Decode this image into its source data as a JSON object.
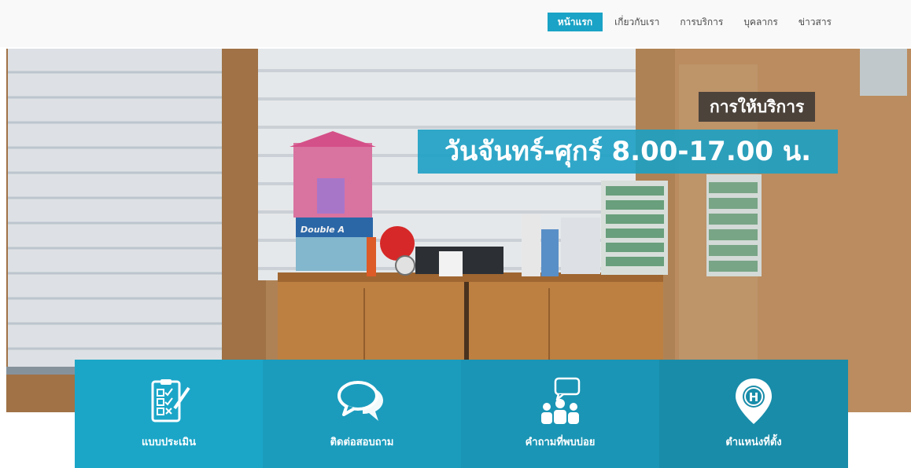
{
  "nav": {
    "items": [
      {
        "label": "หน้าแรก",
        "active": true
      },
      {
        "label": "เกี่ยวกับเรา",
        "active": false
      },
      {
        "label": "การบริการ",
        "active": false
      },
      {
        "label": "บุคลากร",
        "active": false
      },
      {
        "label": "ข่าวสาร",
        "active": false
      }
    ]
  },
  "hero": {
    "title_small": "การให้บริการ",
    "title_big": "วันจันทร์-ศุกร์ 8.00-17.00 น.",
    "box_label": "Double A"
  },
  "tiles": [
    {
      "label": "แบบประเมิน",
      "icon": "checklist-icon",
      "color": "#1ba6c8"
    },
    {
      "label": "ติดต่อสอบถาม",
      "icon": "chat-bubbles-icon",
      "color": "#1b9cbd"
    },
    {
      "label": "คำถามที่พบบ่อย",
      "icon": "faq-people-icon",
      "color": "#1a95b5"
    },
    {
      "label": "ตำแหน่งที่ตั้ง",
      "icon": "location-pin-icon",
      "color": "#198ca9"
    }
  ],
  "colors": {
    "accent": "#1aa3c6",
    "nav_bg": "#f9f9f9"
  }
}
